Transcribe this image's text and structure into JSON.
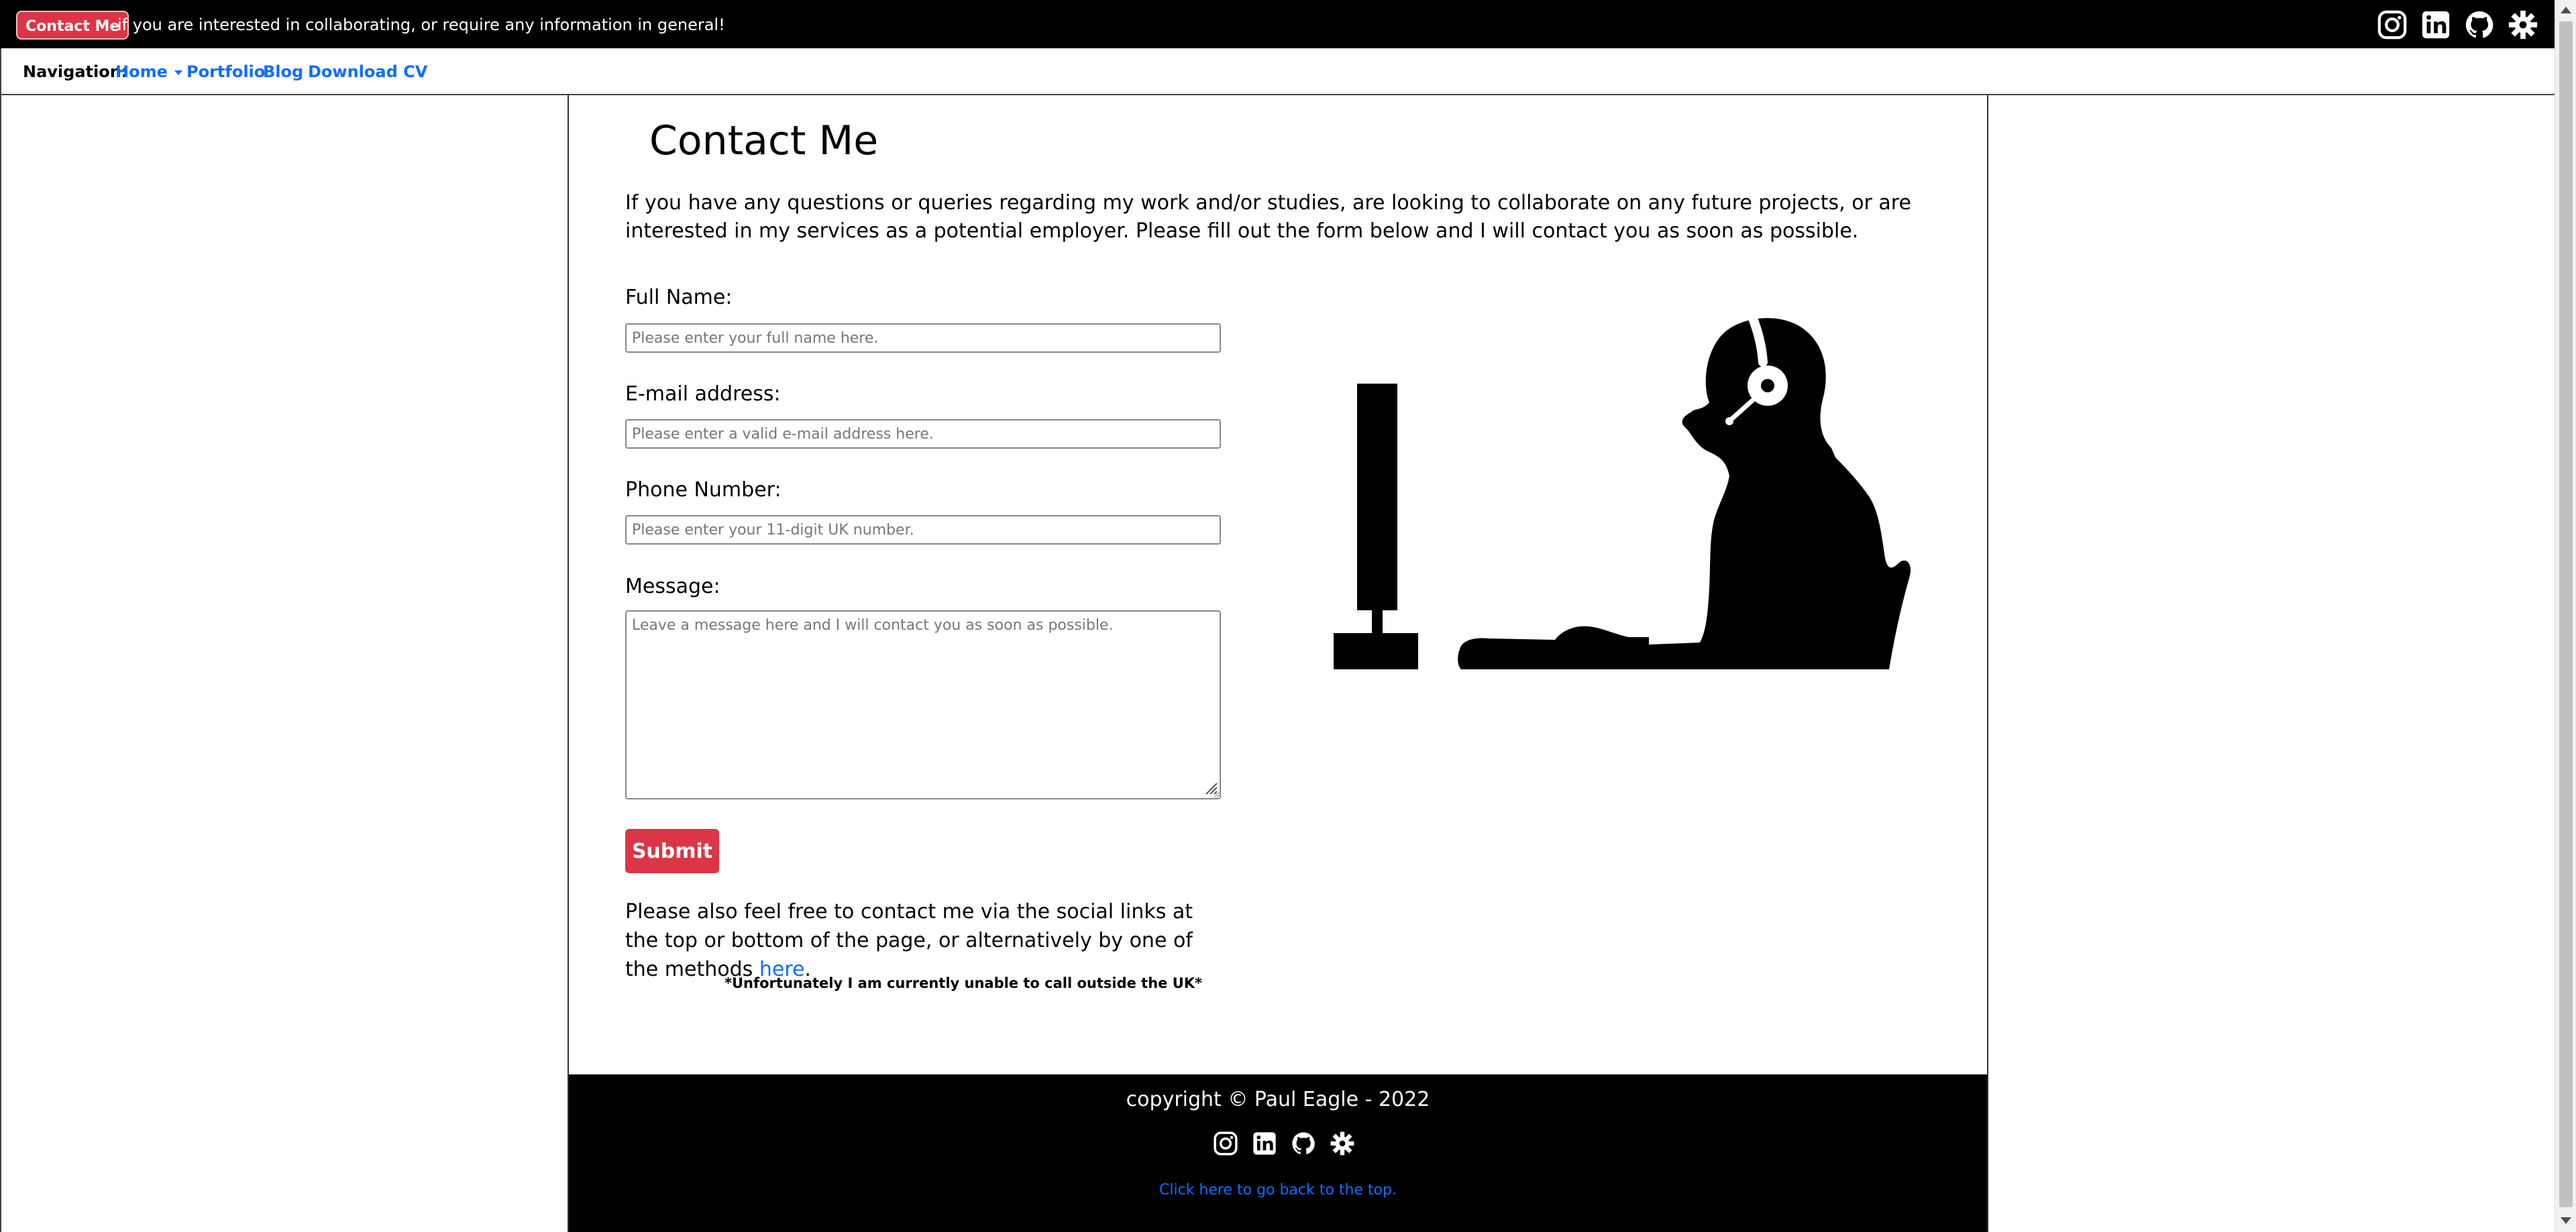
{
  "topbar": {
    "contact_label": "Contact Me",
    "message": "if you are interested in collaborating, or require any information in general!",
    "social_icons": [
      "instagram-icon",
      "linkedin-icon",
      "github-icon",
      "gear-icon"
    ]
  },
  "nav": {
    "label": "Navigation:",
    "items": [
      {
        "label": "Home"
      },
      {
        "label": "Portfolio"
      },
      {
        "label": "Blog"
      },
      {
        "label": "Download CV"
      }
    ]
  },
  "main": {
    "title": "Contact Me",
    "intro": "If you have any questions or queries regarding my work and/or studies, are looking to collaborate on any future projects, or are interested in my services as a potential employer. Please fill out the form below and I will contact you as soon as possible.",
    "form": {
      "fullname_label": "Full Name:",
      "fullname_placeholder": "Please enter your full name here.",
      "email_label": "E-mail address:",
      "email_placeholder": "Please enter a valid e-mail address here.",
      "phone_label": "Phone Number:",
      "phone_placeholder": "Please enter your 11-digit UK number.",
      "message_label": "Message:",
      "message_placeholder": "Leave a message here and I will contact you as soon as possible.",
      "submit_label": "Submit"
    },
    "also_text": "Please also feel free to contact me via the social links at the top or bottom of the page, or alternatively by one of the methods",
    "also_link": "here",
    "also_period": ".",
    "note": "*Unfortunately I am currently unable to call outside the UK*"
  },
  "footer": {
    "copyright": "copyright © Paul Eagle - 2022",
    "back_top": "Click here to go back to the top."
  },
  "colors": {
    "accent": "#dc3545",
    "link": "#0d6efd",
    "bar": "#000000"
  }
}
